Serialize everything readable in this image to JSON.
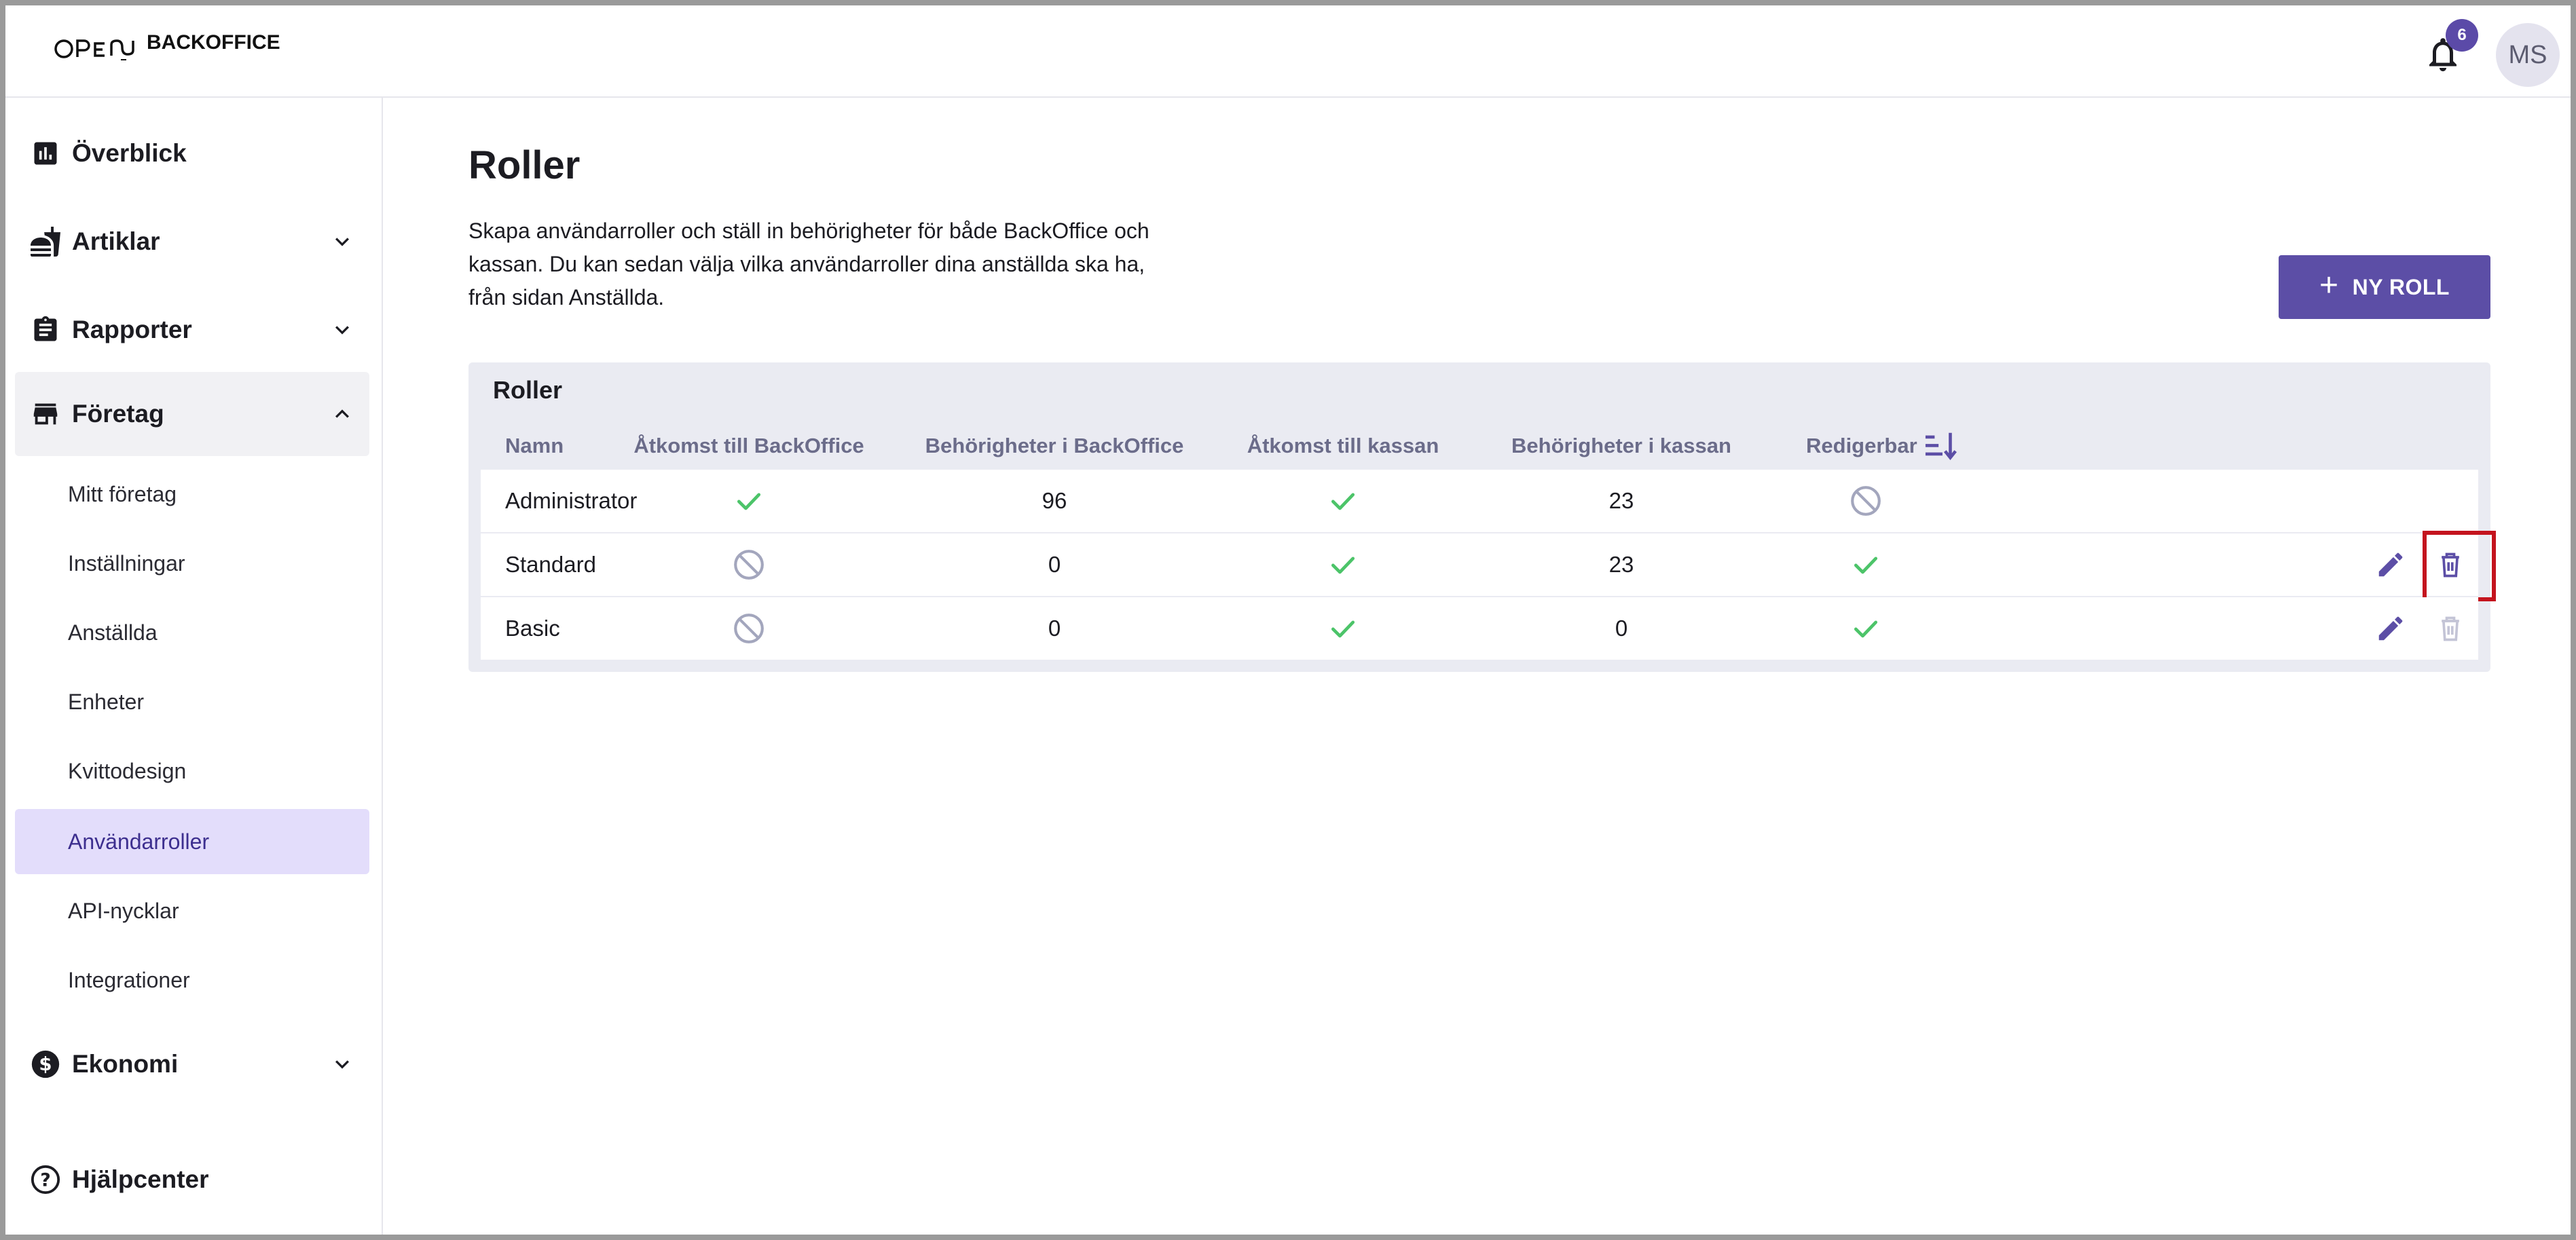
{
  "app": {
    "logo_mark": "OPEN",
    "logo_text": "BACKOFFICE",
    "notifications_count": "6",
    "user_initials": "MS"
  },
  "sidebar": {
    "items": [
      {
        "label": "Överblick",
        "icon": "bar-chart-icon"
      },
      {
        "label": "Artiklar",
        "icon": "food-icon",
        "expanded": false
      },
      {
        "label": "Rapporter",
        "icon": "clipboard-icon",
        "expanded": false
      },
      {
        "label": "Företag",
        "icon": "store-icon",
        "expanded": true
      },
      {
        "label": "Ekonomi",
        "icon": "dollar-icon",
        "expanded": false
      }
    ],
    "company_sub": [
      "Mitt företag",
      "Inställningar",
      "Anställda",
      "Enheter",
      "Kvittodesign",
      "Användarroller",
      "API-nycklar",
      "Integrationer"
    ],
    "selected_sub": "Användarroller",
    "help": "Hjälpcenter"
  },
  "page": {
    "title": "Roller",
    "description": "Skapa användarroller och ställ in behörigheter för både BackOffice och kassan. Du kan sedan välja vilka användarroller dina anställda ska ha, från sidan Anställda.",
    "new_button": "NY ROLL"
  },
  "table": {
    "title": "Roller",
    "columns": [
      "Namn",
      "Åtkomst till BackOffice",
      "Behörigheter i BackOffice",
      "Åtkomst till kassan",
      "Behörigheter i kassan",
      "Redigerbar"
    ],
    "rows": [
      {
        "name": "Administrator",
        "backoffice_access": true,
        "backoffice_permissions": "96",
        "pos_access": true,
        "pos_permissions": "23",
        "editable": false,
        "actions": false
      },
      {
        "name": "Standard",
        "backoffice_access": false,
        "backoffice_permissions": "0",
        "pos_access": true,
        "pos_permissions": "23",
        "editable": true,
        "actions": true,
        "delete_enabled": true
      },
      {
        "name": "Basic",
        "backoffice_access": false,
        "backoffice_permissions": "0",
        "pos_access": true,
        "pos_permissions": "0",
        "editable": true,
        "actions": true,
        "delete_enabled": false
      }
    ]
  },
  "colors": {
    "accent": "#5c4ea6",
    "check": "#4cc469",
    "blocked": "#a3a6bd",
    "highlight": "#c4141e"
  }
}
